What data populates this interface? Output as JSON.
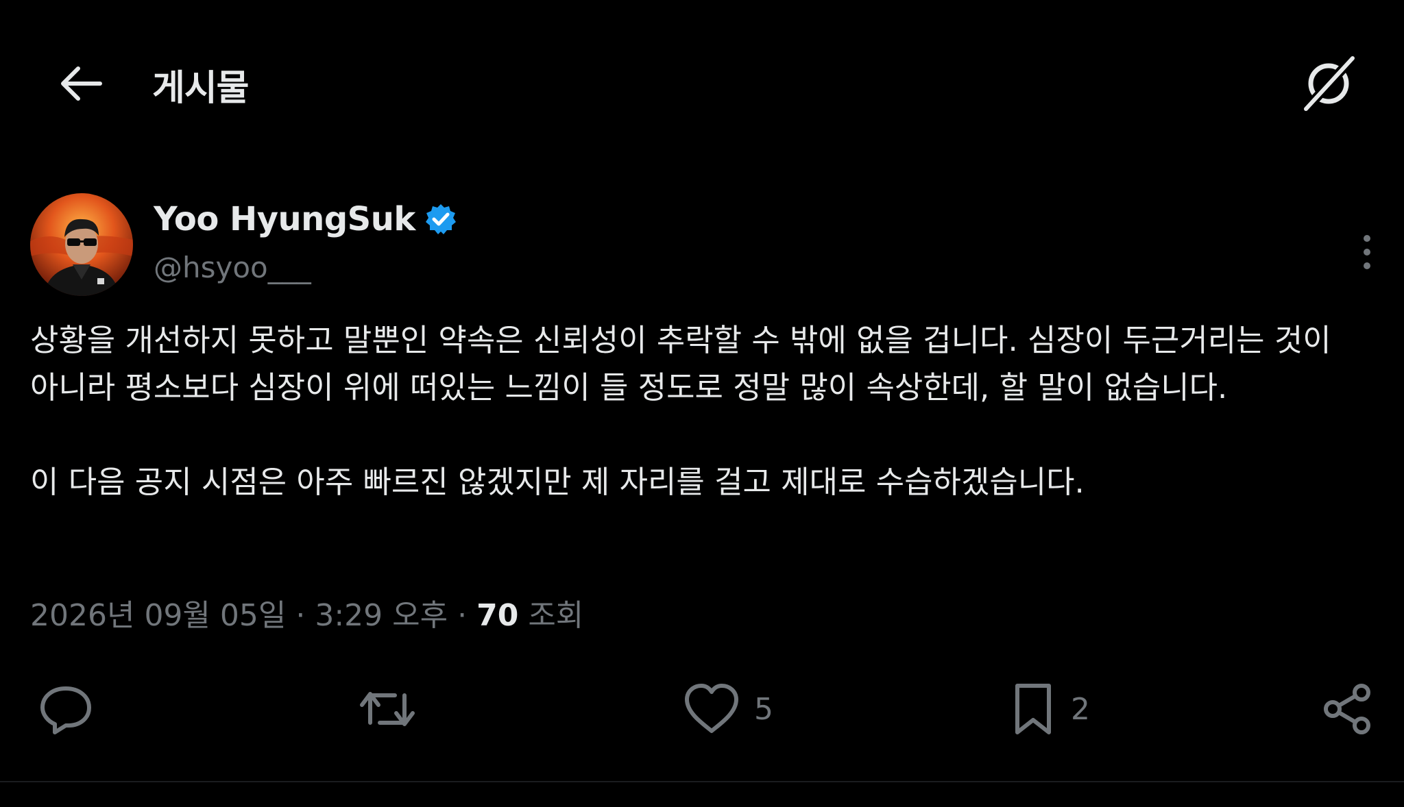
{
  "header": {
    "back_icon": "arrow-left-icon",
    "title": "게시물",
    "grok_icon": "grok-icon"
  },
  "author": {
    "name": "Yoo HyungSuk",
    "verified_icon": "verified-badge-icon",
    "handle": "@hsyoo___",
    "more_icon": "more-vertical-icon"
  },
  "post": {
    "paragraph1": "상황을 개선하지 못하고 말뿐인 약속은 신뢰성이 추락할 수 밖에 없을 겁니다. 심장이 두근거리는 것이 아니라 평소보다 심장이 위에 떠있는 느낌이 들 정도로 정말 많이 속상한데, 할 말이 없습니다.",
    "paragraph2": "이 다음 공지 시점은 아주 빠르진 않겠지만 제 자리를 걸고 제대로 수습하겠습니다."
  },
  "meta": {
    "timestamp": "2026년 09월 05일 · 3:29 오후",
    "separator": "·",
    "views_count": "70",
    "views_label": "조회"
  },
  "actions": {
    "reply": {
      "icon": "reply-icon",
      "count": ""
    },
    "repost": {
      "icon": "repost-icon",
      "count": ""
    },
    "like": {
      "icon": "heart-icon",
      "count": "5"
    },
    "bookmark": {
      "icon": "bookmark-icon",
      "count": "2"
    },
    "share": {
      "icon": "share-icon",
      "count": ""
    }
  },
  "colors": {
    "background": "#000000",
    "text_primary": "#e7e9ea",
    "text_secondary": "#71767b",
    "verified": "#1d9bf0"
  }
}
